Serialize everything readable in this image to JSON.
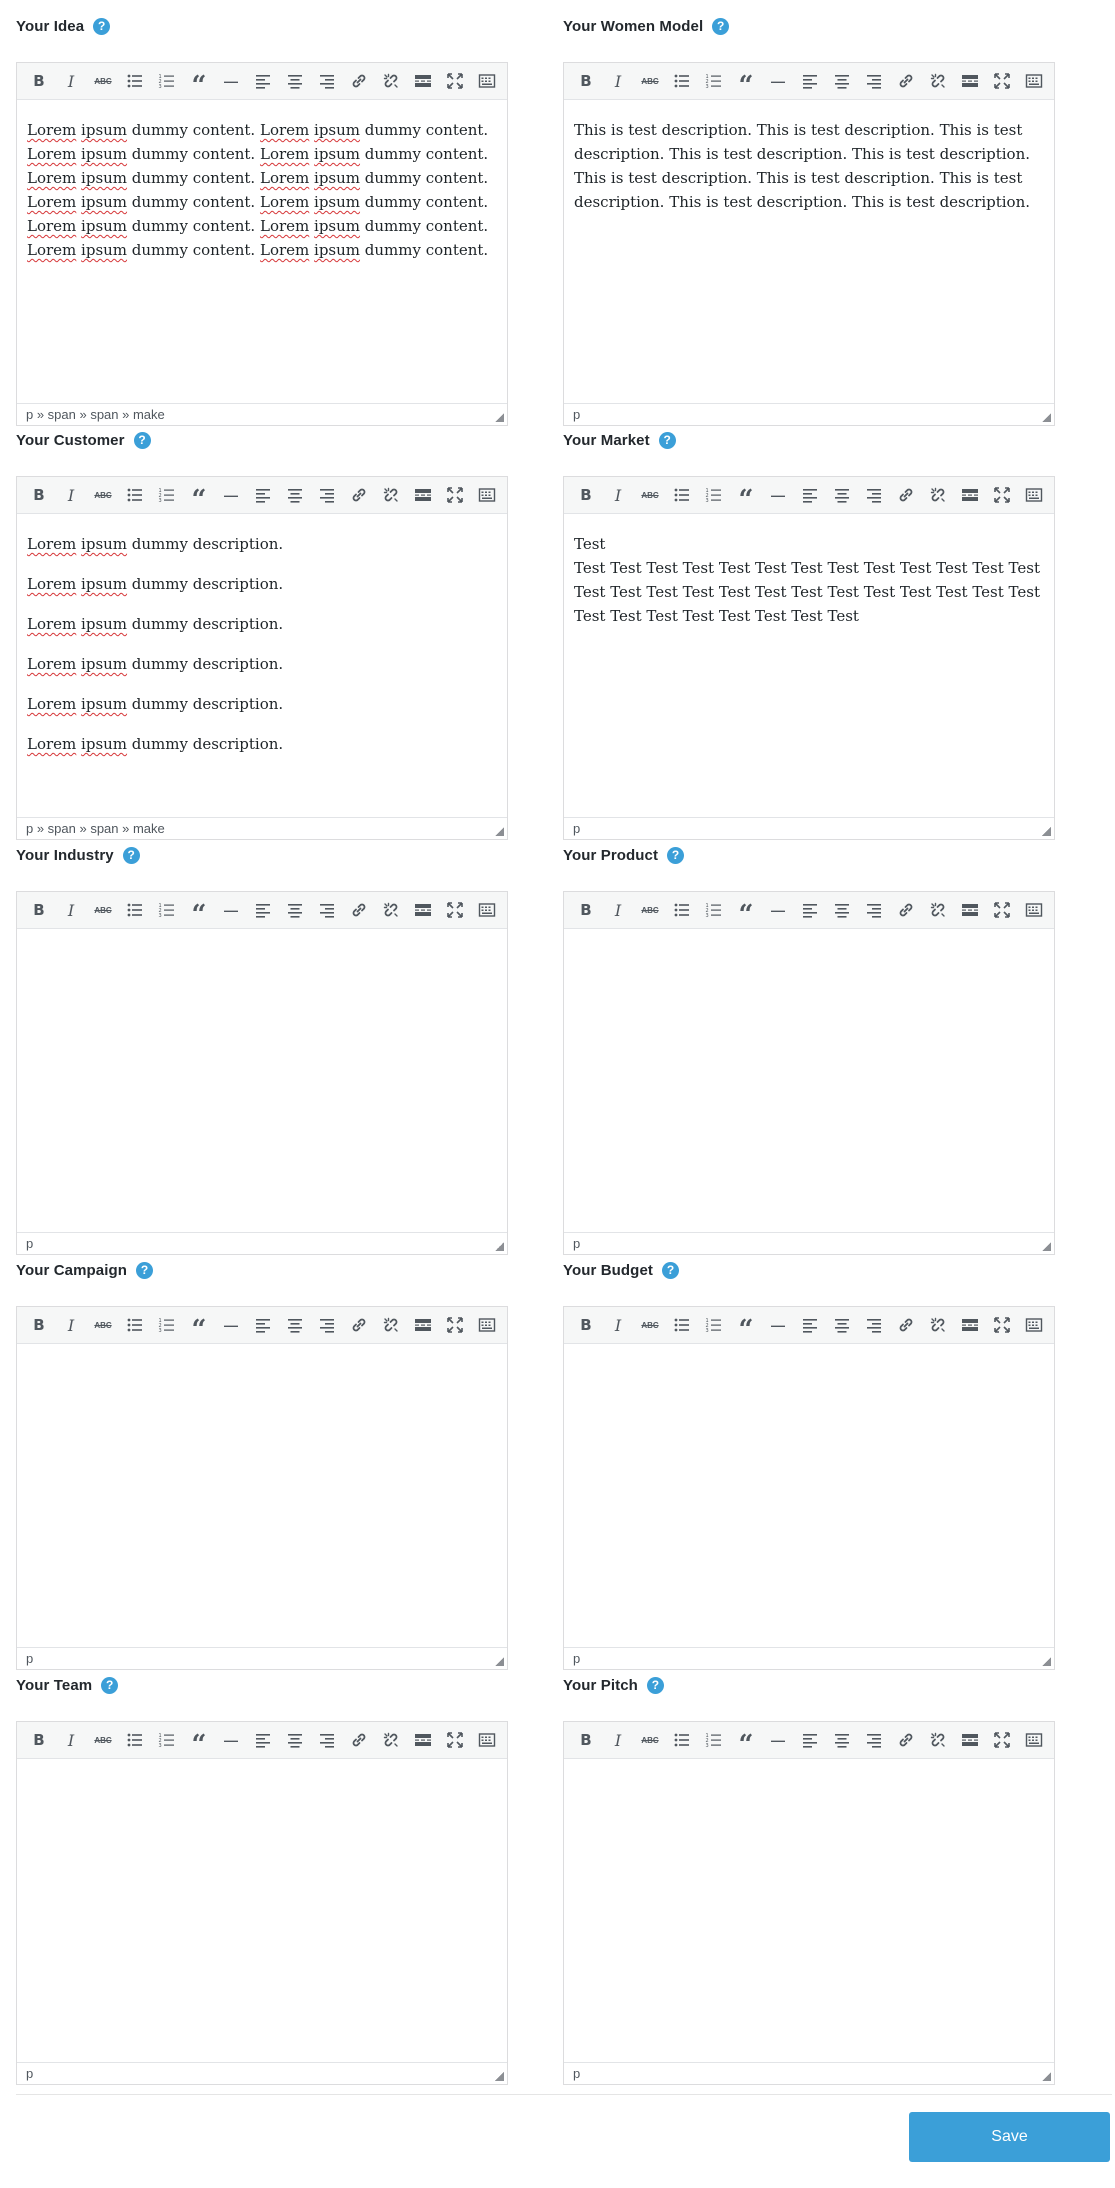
{
  "toolbar_buttons": [
    {
      "name": "bold-icon",
      "glyph": "B",
      "tip": "Bold"
    },
    {
      "name": "italic-icon",
      "glyph": "I",
      "tip": "Italic"
    },
    {
      "name": "strikethrough-icon",
      "glyph": "ABC",
      "tip": "Strikethrough"
    },
    {
      "name": "bullet-list-icon",
      "glyph": "",
      "tip": "Bulleted list"
    },
    {
      "name": "numbered-list-icon",
      "glyph": "",
      "tip": "Numbered list"
    },
    {
      "name": "blockquote-icon",
      "glyph": "“",
      "tip": "Blockquote"
    },
    {
      "name": "horizontal-line-icon",
      "glyph": "—",
      "tip": "Horizontal line"
    },
    {
      "name": "align-left-icon",
      "glyph": "",
      "tip": "Align left"
    },
    {
      "name": "align-center-icon",
      "glyph": "",
      "tip": "Align center"
    },
    {
      "name": "align-right-icon",
      "glyph": "",
      "tip": "Align right"
    },
    {
      "name": "insert-link-icon",
      "glyph": "",
      "tip": "Insert link"
    },
    {
      "name": "remove-link-icon",
      "glyph": "",
      "tip": "Remove link"
    },
    {
      "name": "read-more-icon",
      "glyph": "",
      "tip": "Read more tag"
    },
    {
      "name": "fullscreen-icon",
      "glyph": "",
      "tip": "Fullscreen"
    },
    {
      "name": "toolbar-toggle-icon",
      "glyph": "",
      "tip": "Toolbar toggle"
    }
  ],
  "fields": [
    {
      "id": "idea",
      "label": "Your Idea",
      "status": "p » span » span » make",
      "style": "lines",
      "paragraphs": [
        "Lorem ipsum dummy content. Lorem ipsum dummy content.",
        "Lorem ipsum dummy content. Lorem ipsum dummy content.",
        "Lorem ipsum dummy content. Lorem ipsum dummy content.",
        "Lorem ipsum dummy content. Lorem ipsum dummy content.",
        "Lorem ipsum dummy content. Lorem ipsum dummy content.",
        "Lorem ipsum dummy content. Lorem ipsum dummy content."
      ]
    },
    {
      "id": "women-model",
      "label": "Your Women Model",
      "status": "p",
      "style": "block",
      "paragraphs": [
        "This is test description. This is test description. This is test description. This is test description. This is test description. This is test description. This is test description. This is test description. This is test description. This is test description."
      ]
    },
    {
      "id": "customer",
      "label": "Your Customer",
      "status": "p » span » span » make",
      "style": "paras",
      "paragraphs": [
        "Lorem ipsum dummy description.",
        "Lorem ipsum dummy description.",
        "Lorem ipsum dummy description.",
        "Lorem ipsum dummy description.",
        "Lorem ipsum dummy description.",
        "Lorem ipsum dummy description."
      ]
    },
    {
      "id": "market",
      "label": "Your Market",
      "status": "p",
      "style": "market",
      "paragraphs": [
        "Test",
        "Test Test Test Test Test Test Test Test Test Test Test Test Test Test Test Test Test Test Test Test Test Test Test Test Test Test Test Test Test Test Test Test Test Test"
      ]
    },
    {
      "id": "industry",
      "label": "Your Industry",
      "status": "p",
      "style": "lines",
      "paragraphs": []
    },
    {
      "id": "product",
      "label": "Your Product",
      "status": "p",
      "style": "lines",
      "paragraphs": []
    },
    {
      "id": "campaign",
      "label": "Your Campaign",
      "status": "p",
      "style": "lines",
      "paragraphs": []
    },
    {
      "id": "budget",
      "label": "Your Budget",
      "status": "p",
      "style": "lines",
      "paragraphs": []
    },
    {
      "id": "team",
      "label": "Your Team",
      "status": "p",
      "style": "lines",
      "paragraphs": []
    },
    {
      "id": "pitch",
      "label": "Your Pitch",
      "status": "p",
      "style": "lines",
      "paragraphs": []
    }
  ],
  "help_glyph": "?",
  "save_label": "Save",
  "colors": {
    "accent": "#3b9fd8",
    "toolbar_bg": "#f6f7f7",
    "border": "#dcdcde",
    "spell_underline": "#d63638"
  }
}
